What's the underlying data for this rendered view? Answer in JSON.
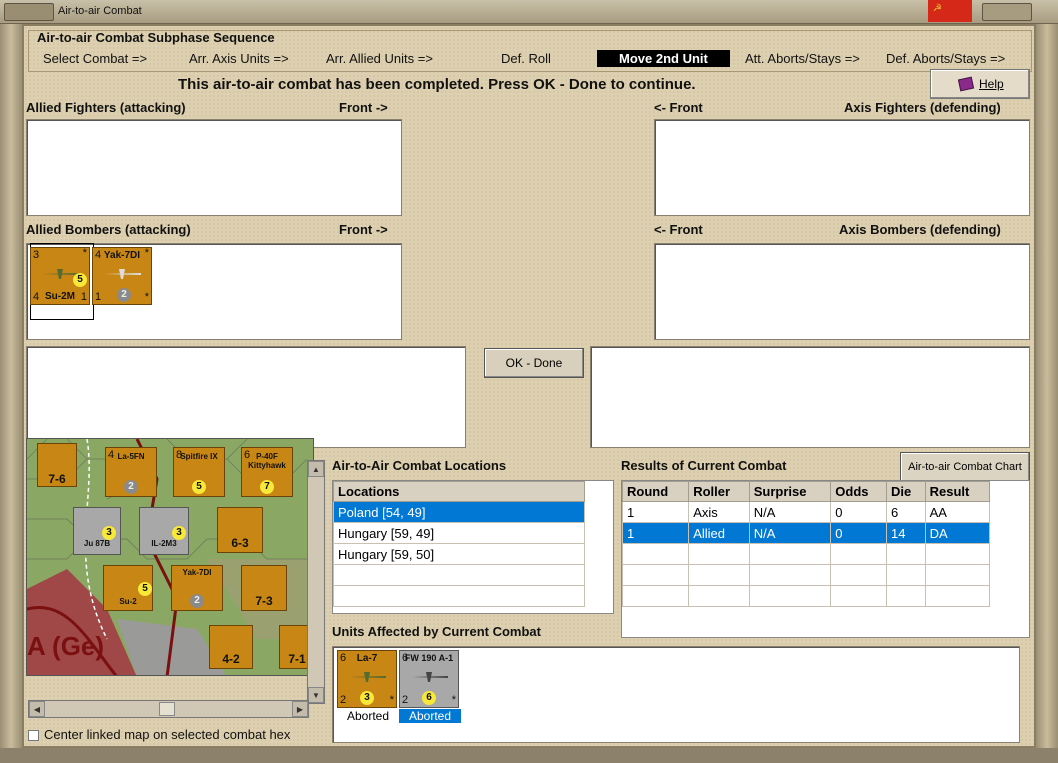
{
  "window": {
    "title": "Air-to-air Combat",
    "flag_glyph": "☭"
  },
  "sequence": {
    "legend": "Air-to-air Combat Subphase Sequence",
    "steps": [
      "Select Combat =>",
      "Arr. Axis Units =>",
      "Arr. Allied Units =>",
      "Def. Roll",
      "Move 2nd Unit",
      "Att. Aborts/Stays =>",
      "Def. Aborts/Stays =>"
    ],
    "active_step": "Move 2nd Unit"
  },
  "message": "This air-to-air combat has been completed.  Press OK - Done to continue.",
  "help_label": "Help",
  "panels": {
    "allied_fighters": {
      "label": "Allied Fighters (attacking)",
      "front": "Front ->"
    },
    "axis_fighters": {
      "label": "Axis Fighters (defending)",
      "front": "<- Front"
    },
    "allied_bombers": {
      "label": "Allied Bombers (attacking)",
      "front": "Front ->"
    },
    "axis_bombers": {
      "label": "Axis Bombers (defending)",
      "front": "<- Front"
    }
  },
  "allied_bomber_units": [
    {
      "name": "Su-2M",
      "tl": "3",
      "bl": "4",
      "br": "1",
      "circle": "5",
      "star": "*"
    },
    {
      "name": "Yak-7DI",
      "tl": "4",
      "bl": "1",
      "br": "*",
      "circle": "2",
      "star": "*"
    }
  ],
  "ok_button": "OK - Done",
  "map": {
    "label": "A (Ge)",
    "counters": [
      "La-5FN",
      "Spitfire IX",
      "P-40F Kittyhawk",
      "Ju 87B",
      "IL-2M3",
      "Su-2",
      "Yak-7DI",
      "7-6",
      "6-3",
      "7-3",
      "4-2",
      "7-1"
    ],
    "counter_numbers": [
      "2",
      "5",
      "7",
      "3",
      "1",
      "3",
      "5",
      "2",
      "1",
      "5",
      "4",
      "6",
      "8",
      "3"
    ]
  },
  "center_map_label": "Center linked map on selected combat hex",
  "locations": {
    "title": "Air-to-Air Combat Locations",
    "header": "Locations",
    "rows": [
      "Poland [54, 49]",
      "Hungary [59, 49]",
      "Hungary [59, 50]",
      "",
      ""
    ],
    "selected_index": 0
  },
  "results": {
    "title": "Results of Current Combat",
    "chart_button": "Air-to-air Combat Chart",
    "columns": [
      "Round",
      "Roller",
      "Surprise",
      "Odds",
      "Die",
      "Result"
    ],
    "rows": [
      [
        "1",
        "Axis",
        "N/A",
        "0",
        "6",
        "AA"
      ],
      [
        "1",
        "Allied",
        "N/A",
        "0",
        "14",
        "DA"
      ],
      [
        "",
        "",
        "",
        "",
        "",
        ""
      ],
      [
        "",
        "",
        "",
        "",
        "",
        ""
      ],
      [
        "",
        "",
        "",
        "",
        "",
        ""
      ]
    ],
    "selected_index": 1
  },
  "affected": {
    "title": "Units Affected by Current Combat",
    "units": [
      {
        "name": "La-7",
        "tl": "6",
        "bl": "2",
        "circle": "3",
        "star": "*",
        "status": "Aborted"
      },
      {
        "name": "FW 190 A-1",
        "tl": "6",
        "bl": "2",
        "circle": "6",
        "star": "*",
        "status": "Aborted"
      }
    ]
  },
  "colors": {
    "counter_allied": "#c88614",
    "counter_axis": "#a8a8a8",
    "selection": "#0078d4",
    "active_step": "#000000"
  }
}
